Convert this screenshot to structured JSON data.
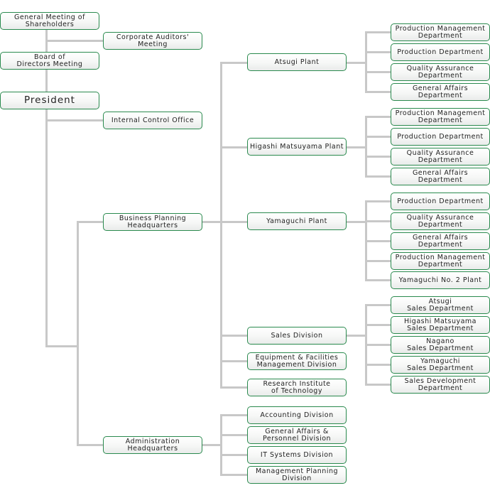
{
  "colors": {
    "box_border": "#2a8a4e",
    "connector": "#c8c8c8",
    "text": "#222222"
  },
  "org": {
    "general_meeting": "General Meeting of\nShareholders",
    "corporate_auditors": "Corporate Auditors'\nMeeting",
    "board": "Board of\nDirectors Meeting",
    "president": "President",
    "internal_control": "Internal Control Office",
    "business_planning_hq": {
      "label": "Business Planning\nHeadquarters",
      "units": [
        {
          "label": "Atsugi Plant",
          "departments": [
            "Production Management\nDepartment",
            "Production Department",
            "Quality Assurance\nDepartment",
            "General Affairs\nDepartment"
          ]
        },
        {
          "label": "Higashi Matsuyama Plant",
          "departments": [
            "Production Management\nDepartment",
            "Production Department",
            "Quality Assurance\nDepartment",
            "General Affairs\nDepartment"
          ]
        },
        {
          "label": "Yamaguchi Plant",
          "departments": [
            "Production Department",
            "Quality Assurance\nDepartment",
            "General Affairs\nDepartment",
            "Production Management\nDepartment",
            "Yamaguchi No. 2 Plant"
          ]
        },
        {
          "label": "Sales Division",
          "departments": [
            "Atsugi\nSales Department",
            "Higashi Matsuyama\nSales Department",
            "Nagano\nSales Department",
            "Yamaguchi\nSales Department",
            "Sales Development\nDepartment"
          ]
        },
        {
          "label": "Equipment & Facilities\nManagement Division",
          "departments": []
        },
        {
          "label": "Research Institute\nof Technology",
          "departments": []
        }
      ]
    },
    "administration_hq": {
      "label": "Administration\nHeadquarters",
      "units": [
        "Accounting Division",
        "General Affairs &\nPersonnel Division",
        "IT Systems Division",
        "Management Planning\nDivision"
      ]
    }
  }
}
